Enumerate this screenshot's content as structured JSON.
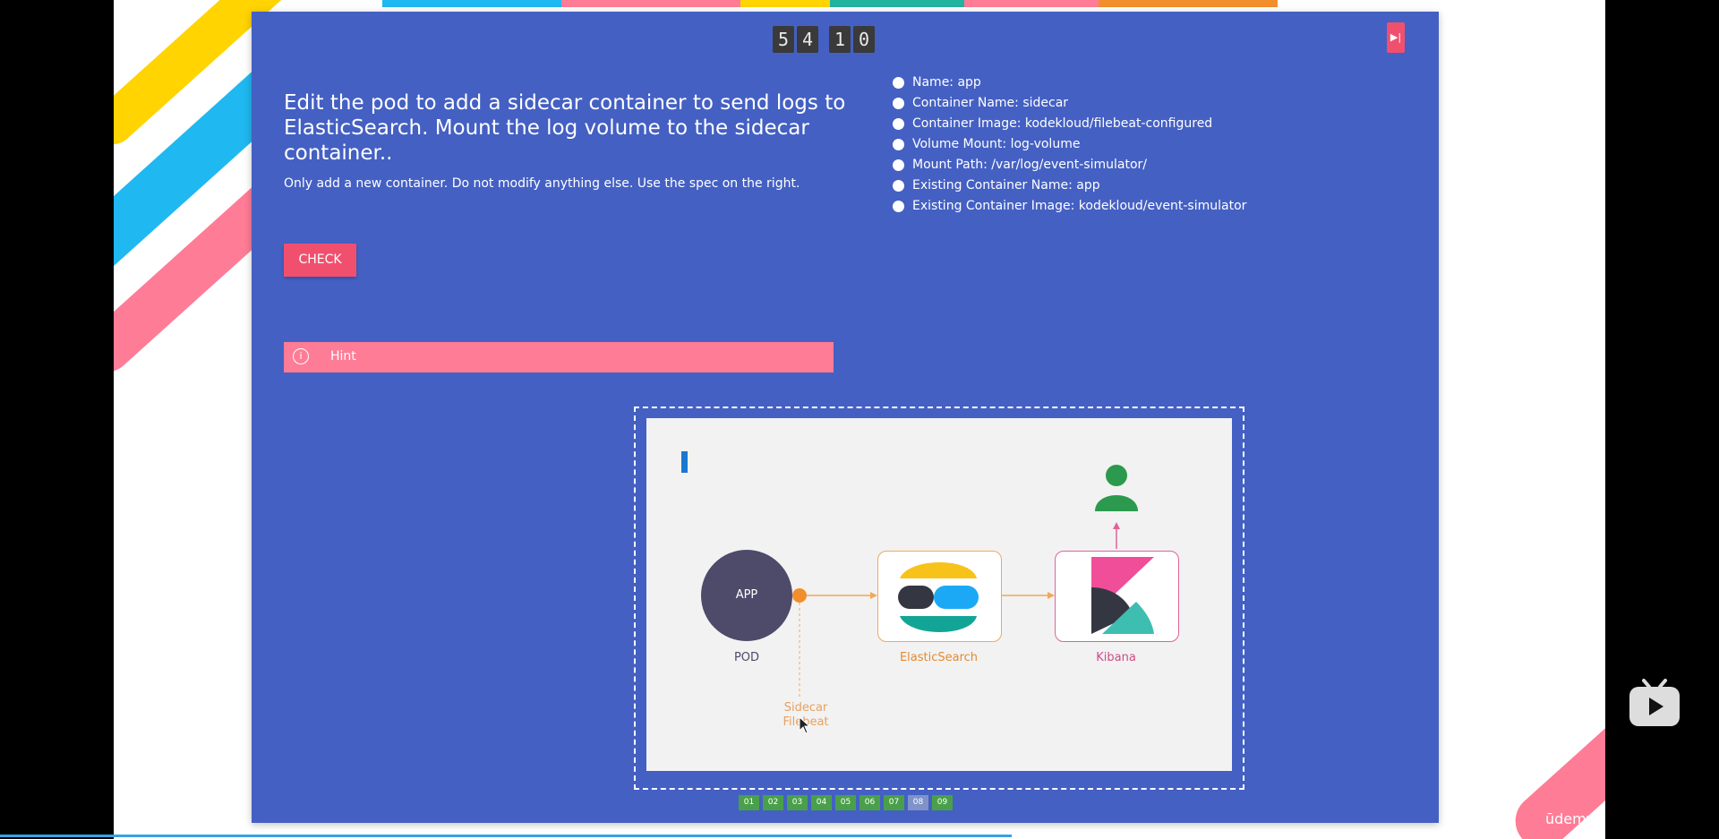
{
  "timer": {
    "digits": [
      "5",
      "4",
      "1",
      "0"
    ]
  },
  "question": {
    "title": "Edit the pod to add a sidecar container to send logs to ElasticSearch. Mount the log volume to the sidecar container..",
    "subtitle": "Only add a new container. Do not modify anything else. Use the spec on the right."
  },
  "check_label": "CHECK",
  "hint_label": "Hint",
  "specs": [
    "Name: app",
    "Container Name: sidecar",
    "Container Image: kodekloud/filebeat-configured",
    "Volume Mount: log-volume",
    "Mount Path: /var/log/event-simulator/",
    "Existing Container Name: app",
    "Existing Container Image: kodekloud/event-simulator"
  ],
  "diagram": {
    "app_label": "APP",
    "pod_label": "POD",
    "elasticsearch_label": "ElasticSearch",
    "kibana_label": "Kibana",
    "sidecar_line1": "Sidecar",
    "sidecar_line2": "Filebeat"
  },
  "pager": [
    "01",
    "02",
    "03",
    "04",
    "05",
    "06",
    "07",
    "08",
    "09"
  ],
  "active_page": "08",
  "watermark": "ūdemy",
  "colors": {
    "panel": "#4460c3",
    "accent": "#f0506e",
    "hint": "#ff7c96",
    "pager": "#4aa04a"
  }
}
